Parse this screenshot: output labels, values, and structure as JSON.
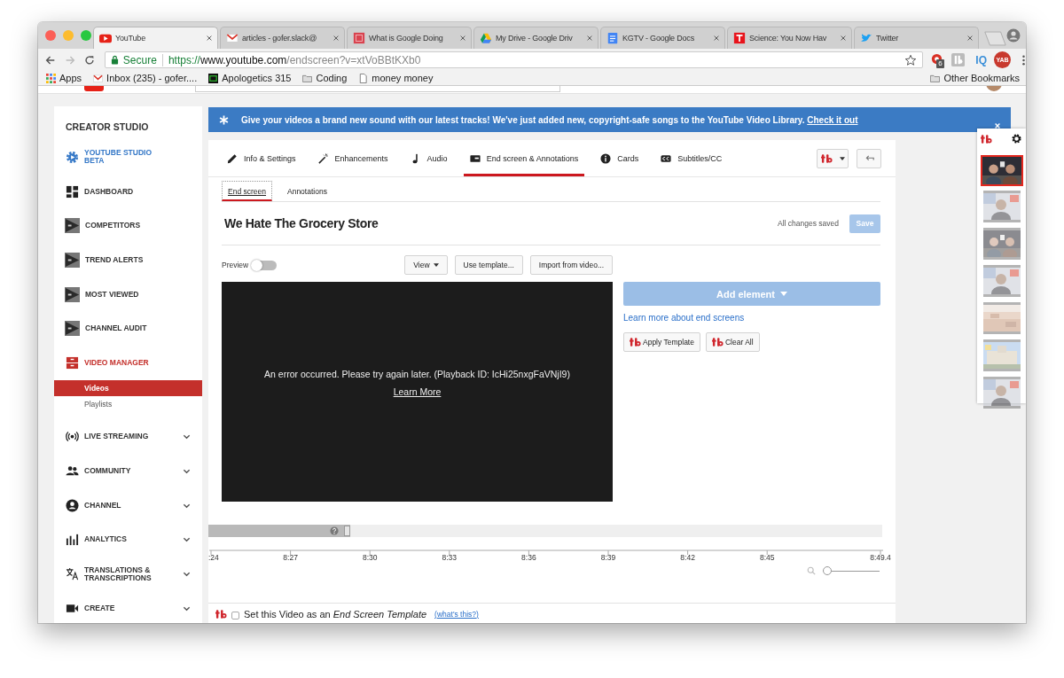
{
  "tabs": [
    {
      "title": "YouTube",
      "selected": true
    },
    {
      "title": "articles - gofer.slack@",
      "selected": false
    },
    {
      "title": "What is Google Doing",
      "selected": false
    },
    {
      "title": "My Drive - Google Driv",
      "selected": false
    },
    {
      "title": "KGTV - Google Docs",
      "selected": false
    },
    {
      "title": "Science: You Now Hav",
      "selected": false
    },
    {
      "title": "Twitter",
      "selected": false
    }
  ],
  "toolbar": {
    "secure_label": "Secure",
    "url": {
      "scheme": "https://",
      "host": "www.youtube.com",
      "path": "/endscreen?v=xtVoBBtKXb0"
    },
    "extensions": [
      {
        "kind": "badge",
        "badge": "6"
      },
      {
        "kind": "logo"
      },
      {
        "kind": "text",
        "label": "IQ"
      },
      {
        "kind": "round",
        "label": "YAB"
      }
    ]
  },
  "bookmarks": [
    {
      "kind": "apps",
      "label": "Apps"
    },
    {
      "kind": "mail",
      "label": "Inbox (235) - gofer...."
    },
    {
      "kind": "site",
      "label": "Apologetics 315"
    },
    {
      "kind": "folder",
      "label": "Coding"
    },
    {
      "kind": "page",
      "label": "money money"
    }
  ],
  "other_bookmarks": "Other Bookmarks",
  "sidebar": {
    "title": "CREATOR STUDIO",
    "items": [
      {
        "label": "YOUTUBE STUDIO BETA",
        "kind": "external",
        "selected": false
      },
      {
        "label": "DASHBOARD",
        "kind": "page",
        "selected": false
      },
      {
        "label": "COMPETITORS",
        "kind": "page",
        "selected": false
      },
      {
        "label": "TREND ALERTS",
        "kind": "page",
        "selected": false
      },
      {
        "label": "MOST VIEWED",
        "kind": "page",
        "selected": false
      },
      {
        "label": "CHANNEL AUDIT",
        "kind": "page",
        "selected": false
      },
      {
        "label": "VIDEO MANAGER",
        "kind": "page",
        "selected": true,
        "children": [
          {
            "label": "Videos",
            "selected": true
          },
          {
            "label": "Playlists",
            "selected": false
          }
        ]
      },
      {
        "label": "LIVE STREAMING",
        "kind": "page",
        "selected": false,
        "expanded": false
      },
      {
        "label": "COMMUNITY",
        "kind": "page",
        "selected": false,
        "expanded": false
      },
      {
        "label": "CHANNEL",
        "kind": "page",
        "selected": false,
        "expanded": false
      },
      {
        "label": "ANALYTICS",
        "kind": "page",
        "selected": false,
        "expanded": false
      },
      {
        "label": "TRANSLATIONS & TRANSCRIPTIONS",
        "kind": "page",
        "selected": false,
        "expanded": false
      },
      {
        "label": "CREATE",
        "kind": "page",
        "selected": false,
        "expanded": false
      }
    ]
  },
  "banner": {
    "text": "Give your videos a brand new sound with our latest tracks! We've just added new, copyright-safe songs to the YouTube Video Library.",
    "link": "Check it out"
  },
  "editor": {
    "tabs": [
      {
        "label": "Info & Settings",
        "selected": false
      },
      {
        "label": "Enhancements",
        "selected": false
      },
      {
        "label": "Audio",
        "selected": false
      },
      {
        "label": "End screen & Annotations",
        "selected": true
      },
      {
        "label": "Cards",
        "selected": false
      },
      {
        "label": "Subtitles/CC",
        "selected": false
      }
    ],
    "subtabs": [
      {
        "label": "End screen",
        "selected": true
      },
      {
        "label": "Annotations",
        "selected": false
      }
    ],
    "video_title": "We Hate The Grocery Store",
    "save_status": "All changes saved",
    "save_button": {
      "label": "Save",
      "disabled": true
    },
    "preview": {
      "label": "Preview",
      "on": false
    },
    "tools": [
      {
        "label": "View",
        "dropdown": true
      },
      {
        "label": "Use template...",
        "dropdown": false
      },
      {
        "label": "Import from video...",
        "dropdown": false
      }
    ],
    "player": {
      "error": "An error occurred. Please try again later. (Playback ID: IcHi25nxgFaVNjI9)",
      "link": "Learn More"
    },
    "add_element": "Add element",
    "learn_link": "Learn more about end screens",
    "actions": [
      "Apply Template",
      "Clear All"
    ],
    "timeline": {
      "end_screen_bar": {
        "level": 0.21
      },
      "labels": [
        ":24",
        "8:27",
        "8:30",
        "8:33",
        "8:36",
        "8:39",
        "8:42",
        "8:45",
        "8:49.4"
      ],
      "zoom": {
        "level": 0
      }
    },
    "template_row": {
      "checked": false,
      "text": "Set this Video as an *End Screen Template*",
      "link": "(what's this?)"
    }
  },
  "panel": {
    "thumbnails": [
      {
        "selected": true
      },
      {
        "selected": false
      },
      {
        "selected": false
      },
      {
        "selected": false
      },
      {
        "selected": false
      },
      {
        "selected": false
      },
      {
        "selected": false
      }
    ]
  }
}
